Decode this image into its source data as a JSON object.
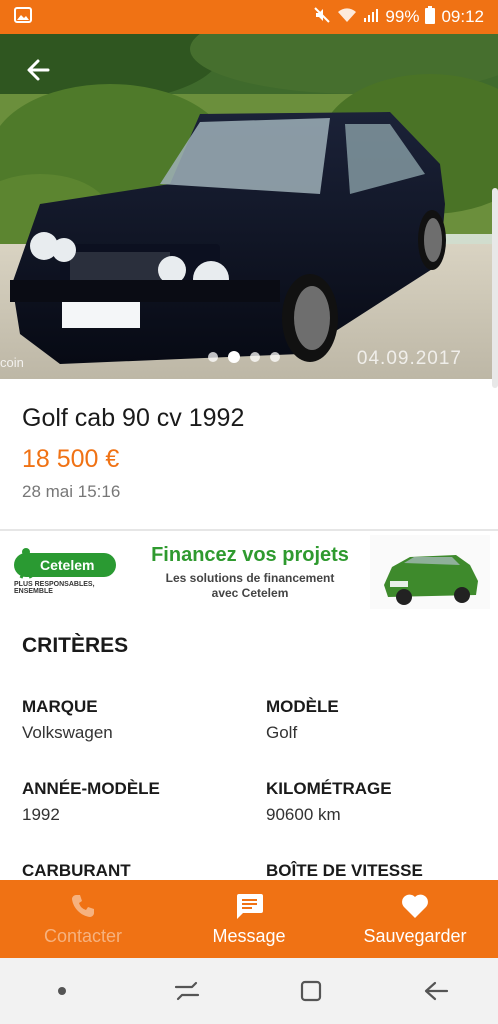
{
  "status_bar": {
    "battery": "99%",
    "time": "09:12",
    "icons": [
      "image-notification-icon",
      "mute-icon",
      "wifi-icon",
      "signal-icon",
      "battery-icon"
    ]
  },
  "gallery": {
    "date_stamp": "04.09.2017",
    "watermark": "coin",
    "page_count": 4,
    "current_page": 2
  },
  "listing": {
    "title": "Golf cab 90 cv 1992",
    "price": "18 500 €",
    "posted": "28 mai 15:16"
  },
  "banner": {
    "brand": "Cetelem",
    "brand_tagline": "PLUS RESPONSABLES, ENSEMBLE",
    "headline": "Financez vos projets",
    "sub_line1": "Les solutions de financement",
    "sub_line2": "avec Cetelem"
  },
  "criteria": {
    "heading": "CRITÈRES",
    "items": [
      {
        "label": "MARQUE",
        "value": "Volkswagen"
      },
      {
        "label": "MODÈLE",
        "value": "Golf"
      },
      {
        "label": "ANNÉE-MODÈLE",
        "value": "1992"
      },
      {
        "label": "KILOMÉTRAGE",
        "value": "90600 km"
      },
      {
        "label": "CARBURANT",
        "value": ""
      },
      {
        "label": "BOÎTE DE VITESSE",
        "value": ""
      }
    ]
  },
  "actions": {
    "contact": "Contacter",
    "message": "Message",
    "save": "Sauvegarder"
  },
  "colors": {
    "accent": "#f07214",
    "banner_green": "#2f9a2f"
  }
}
